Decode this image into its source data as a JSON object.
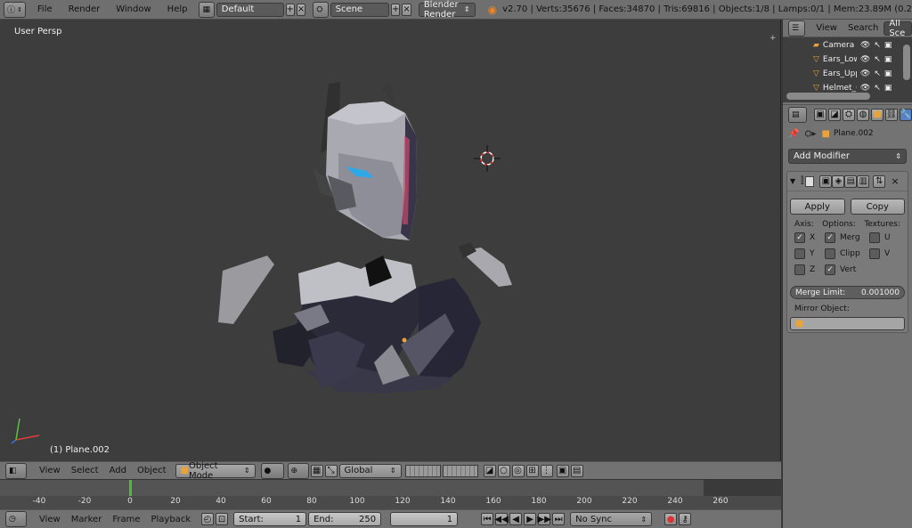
{
  "top": {
    "menus": [
      "File",
      "Render",
      "Window",
      "Help"
    ],
    "layout": "Default",
    "scene": "Scene",
    "engine": "Blender Render",
    "stats": "v2.70 | Verts:35676 | Faces:34870 | Tris:69816 | Objects:1/8 | Lamps:0/1 | Mem:23.89M (0.2"
  },
  "viewport": {
    "view_label": "User Persp",
    "object_label": "(1) Plane.002"
  },
  "v3d_header": {
    "menus": [
      "View",
      "Select",
      "Add",
      "Object"
    ],
    "mode": "Object Mode",
    "orientation": "Global"
  },
  "timeline": {
    "ticks": [
      "-40",
      "-20",
      "0",
      "20",
      "40",
      "60",
      "80",
      "100",
      "120",
      "140",
      "160",
      "180",
      "200",
      "220",
      "240",
      "260"
    ],
    "current_frame_value": 0,
    "menus": [
      "View",
      "Marker",
      "Frame",
      "Playback"
    ],
    "start_label": "Start:",
    "start": "1",
    "end_label": "End:",
    "end": "250",
    "frame": "1",
    "sync": "No Sync"
  },
  "outliner": {
    "menus": [
      "View",
      "Search"
    ],
    "filter": "All Sce",
    "items": [
      "Camera",
      "Ears_Low",
      "Ears_Upp",
      "Helmet_("
    ]
  },
  "properties": {
    "object_name": "Plane.002",
    "add_modifier": "Add Modifier",
    "apply": "Apply",
    "copy": "Copy",
    "axis_header": "Axis:",
    "options_header": "Options:",
    "textures_header": "Textures:",
    "axis": [
      {
        "label": "X",
        "checked": true
      },
      {
        "label": "Y",
        "checked": false
      },
      {
        "label": "Z",
        "checked": false
      }
    ],
    "options": [
      {
        "label": "Merg",
        "checked": true
      },
      {
        "label": "Clipp",
        "checked": false
      },
      {
        "label": "Vert",
        "checked": true
      }
    ],
    "textures": [
      {
        "label": "U",
        "checked": false
      },
      {
        "label": "V",
        "checked": false
      }
    ],
    "merge_limit_label": "Merge Limit:",
    "merge_limit": "0.001000",
    "mirror_object": "Mirror Object:"
  },
  "colors": {
    "accent_blue": "#2ea8e6",
    "frame_green": "#4bbf34",
    "selected_orange": "#e8a33a"
  }
}
